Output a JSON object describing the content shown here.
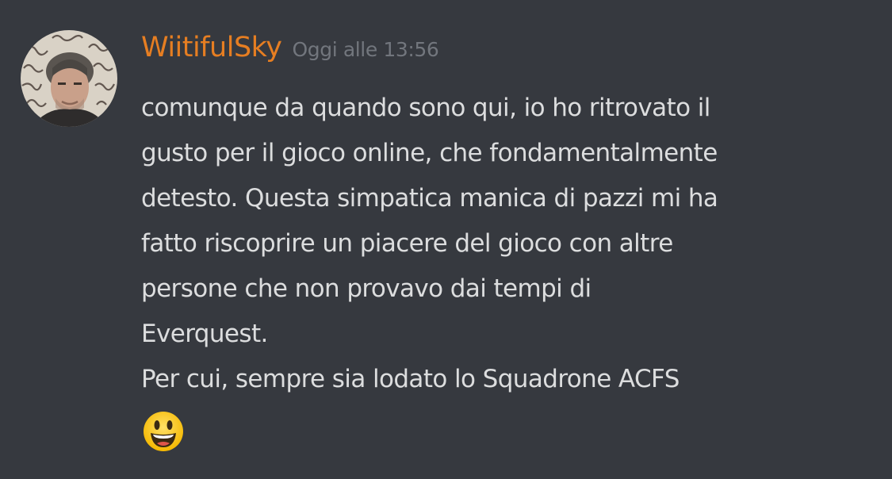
{
  "author": {
    "username": "WiitifulSky",
    "timestamp": "Oggi alle 13:56",
    "username_color": "#e67e22"
  },
  "message": {
    "lines": [
      "comunque da quando sono qui, io ho ritrovato il",
      "gusto per il gioco online, che fondamentalmente",
      "detesto. Questa simpatica manica di pazzi mi ha",
      "fatto riscoprire un piacere del gioco con altre",
      "persone che non provavo dai tempi di",
      "Everquest.",
      "Per cui, sempre sia lodato lo Squadrone ACFS"
    ],
    "emoji": "smiley-face-emoji"
  },
  "colors": {
    "background": "#36393f",
    "text": "#dcddde",
    "timestamp": "#72767d"
  }
}
